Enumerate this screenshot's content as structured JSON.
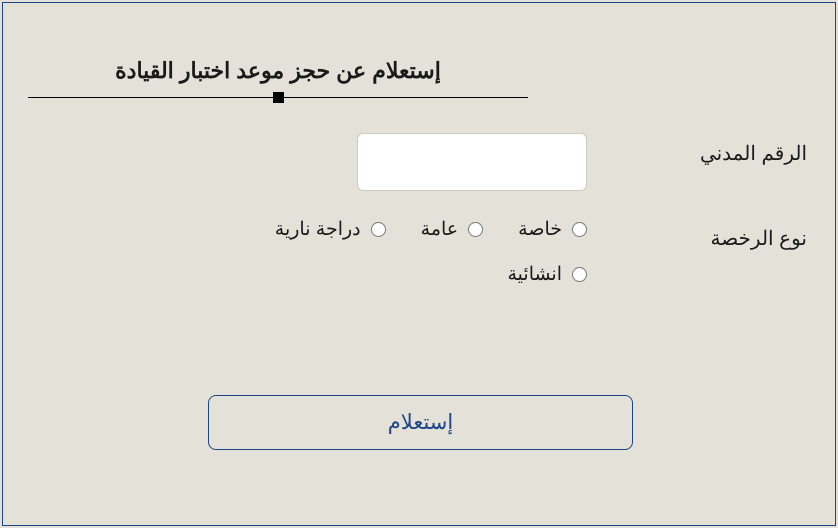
{
  "title": "إستعلام عن حجز موعد اختبار القيادة",
  "fields": {
    "civil_id_label": "الرقم المدني",
    "civil_id_value": "",
    "license_type_label": "نوع الرخصة",
    "license_options": {
      "private": "خاصة",
      "public": "عامة",
      "motorcycle": "دراجة نارية",
      "construction": "انشائية"
    }
  },
  "submit_label": "إستعلام"
}
